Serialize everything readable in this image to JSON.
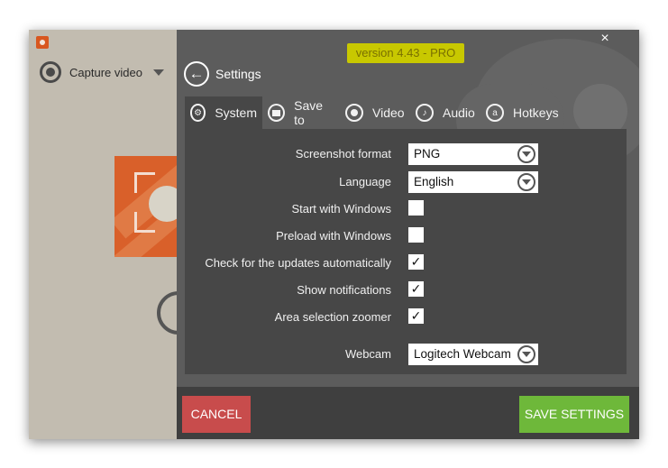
{
  "left_pane": {
    "capture_label": "Capture video"
  },
  "header": {
    "version": "version 4.43 - PRO",
    "title": "Settings",
    "close_glyph": "×"
  },
  "tabs": [
    {
      "label": "System",
      "icon": "gears-icon",
      "active": true
    },
    {
      "label": "Save to",
      "icon": "folder-icon",
      "active": false
    },
    {
      "label": "Video",
      "icon": "record-icon",
      "active": false
    },
    {
      "label": "Audio",
      "icon": "speaker-icon",
      "active": false
    },
    {
      "label": "Hotkeys",
      "icon": "keyboard-icon",
      "active": false
    }
  ],
  "settings": {
    "screenshot_format": {
      "label": "Screenshot format",
      "value": "PNG"
    },
    "language": {
      "label": "Language",
      "value": "English"
    },
    "start_with_windows": {
      "label": "Start with Windows",
      "checked": false
    },
    "preload_with_windows": {
      "label": "Preload with Windows",
      "checked": false
    },
    "check_updates": {
      "label": "Check for the updates automatically",
      "checked": true
    },
    "show_notifications": {
      "label": "Show notifications",
      "checked": true
    },
    "area_zoomer": {
      "label": "Area selection zoomer",
      "checked": true
    },
    "webcam": {
      "label": "Webcam",
      "value": "Logitech Webcam"
    }
  },
  "footer": {
    "cancel_label": "CANCEL",
    "save_label": "SAVE SETTINGS"
  },
  "colors": {
    "panel": "#5c5c5c",
    "content": "#474747",
    "cancel": "#c84c4c",
    "save": "#6eb83a",
    "version_highlight": "#c8c800",
    "brand": "#d9602a"
  }
}
